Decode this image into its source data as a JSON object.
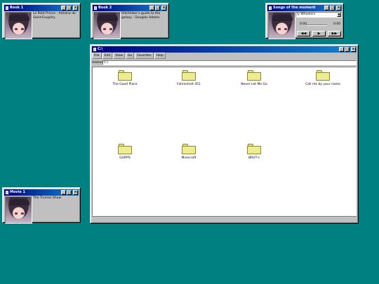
{
  "colors": {
    "desktop": "#008080",
    "titlebar": "#000080",
    "window": "#c0c0c0",
    "folder": "#eeec90"
  },
  "book1": {
    "title": "Book 1",
    "caption": "Le Petit Prince - Antoine de Saint-Exupéry"
  },
  "book2": {
    "title": "Book 2",
    "caption": "Hitchhiker's guide to the galaxy - Douglas Adams"
  },
  "movie1": {
    "title": "Movie 1",
    "caption": "The Truman Show"
  },
  "player": {
    "title": "Songs of the moment",
    "selected": "ly Wheelers",
    "time_elapsed": "0:00",
    "time_total": "0:00",
    "prev_label": "◀◀",
    "play_label": "▶",
    "next_label": "▶▶"
  },
  "explorer": {
    "title": "C:\\",
    "menus": [
      "File",
      "Edit",
      "View",
      "Go",
      "Favorites",
      "Help"
    ],
    "address_label": "Address",
    "address_value": "C:\\",
    "folders": [
      "The Good Place",
      "Fahrenheit 451",
      "Never Let Me Go",
      "Call me by your name",
      "GURPS",
      "Minecraft",
      "BRUT-s"
    ]
  }
}
